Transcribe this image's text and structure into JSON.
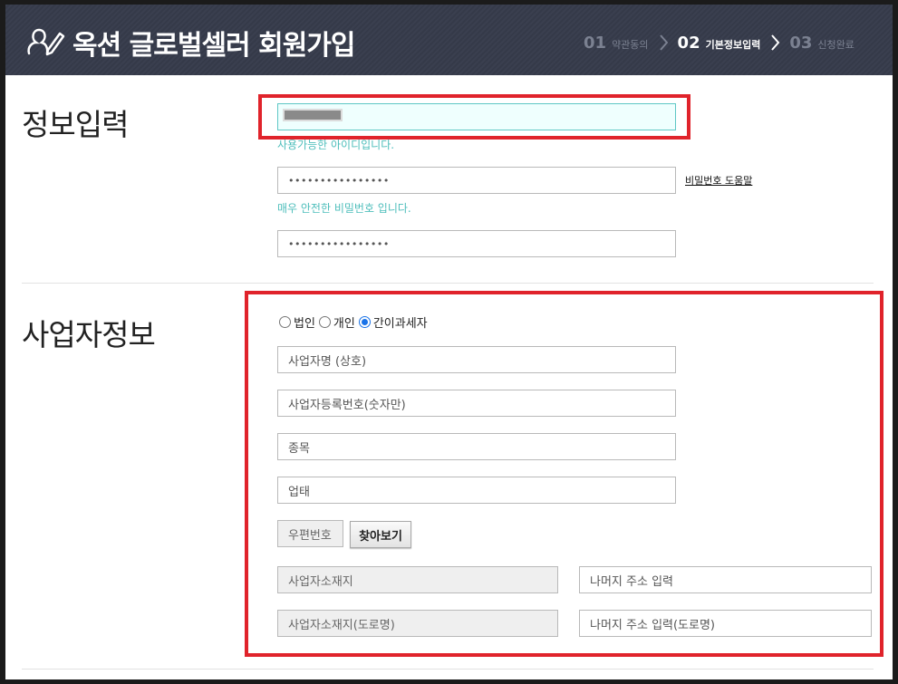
{
  "header": {
    "title": "옥션 글로벌셀러 회원가입",
    "steps": [
      {
        "num": "01",
        "label": "약관동의"
      },
      {
        "num": "02",
        "label": "기본정보입력"
      },
      {
        "num": "03",
        "label": "신청완료"
      }
    ],
    "active_step": "02"
  },
  "info_section": {
    "title": "정보입력",
    "id_hint": "사용가능한 아이디입니다.",
    "password_value": "••••••••••••••••",
    "password_help_link": "비밀번호 도움말",
    "password_hint": "매우 안전한 비밀번호 입니다.",
    "password_confirm_value": "••••••••••••••••"
  },
  "business_section": {
    "title": "사업자정보",
    "business_types": [
      {
        "label": "법인",
        "checked": false
      },
      {
        "label": "개인",
        "checked": false
      },
      {
        "label": "간이과세자",
        "checked": true
      }
    ],
    "business_name_placeholder": "사업자명 (상호)",
    "registration_number_placeholder": "사업자등록번호(숫자만)",
    "business_item_placeholder": "종목",
    "business_category_placeholder": "업태",
    "zipcode_placeholder": "우편번호",
    "search_button": "찾아보기",
    "address_placeholder": "사업자소재지",
    "address_detail_placeholder": "나머지 주소 입력",
    "road_address_placeholder": "사업자소재지(도로명)",
    "road_address_detail_placeholder": "나머지 주소 입력(도로명)"
  },
  "colors": {
    "header_bg": "#3a3f4f",
    "highlight_red": "#e0232b",
    "hint_teal": "#4ebebb"
  }
}
